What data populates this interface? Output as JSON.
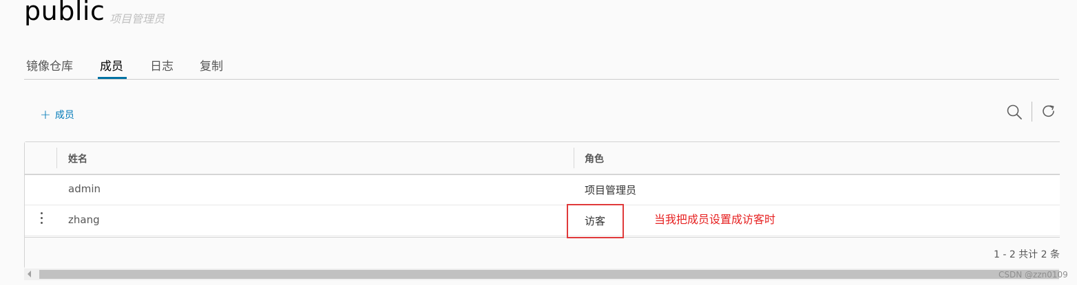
{
  "header": {
    "title": "public",
    "role_subtitle": "项目管理员"
  },
  "tabs": [
    {
      "label": "镜像仓库"
    },
    {
      "label": "成员",
      "active": true
    },
    {
      "label": "日志"
    },
    {
      "label": "复制"
    }
  ],
  "toolbar": {
    "add_member_label": "成员",
    "icons": [
      "search-icon",
      "refresh-icon"
    ]
  },
  "table": {
    "columns": [
      "姓名",
      "角色"
    ],
    "rows": [
      {
        "name": "admin",
        "role": "项目管理员"
      },
      {
        "name": "zhang",
        "role": "访客"
      }
    ],
    "pagination": "1 - 2 共计 2 条"
  },
  "annotation": {
    "text": "当我把成员设置成访客时",
    "color": "#e62020"
  },
  "watermark": "CSDN @zzn0109",
  "colors": {
    "accent": "#0072a3",
    "link": "#0079b8",
    "highlight_border": "#e0393a"
  }
}
